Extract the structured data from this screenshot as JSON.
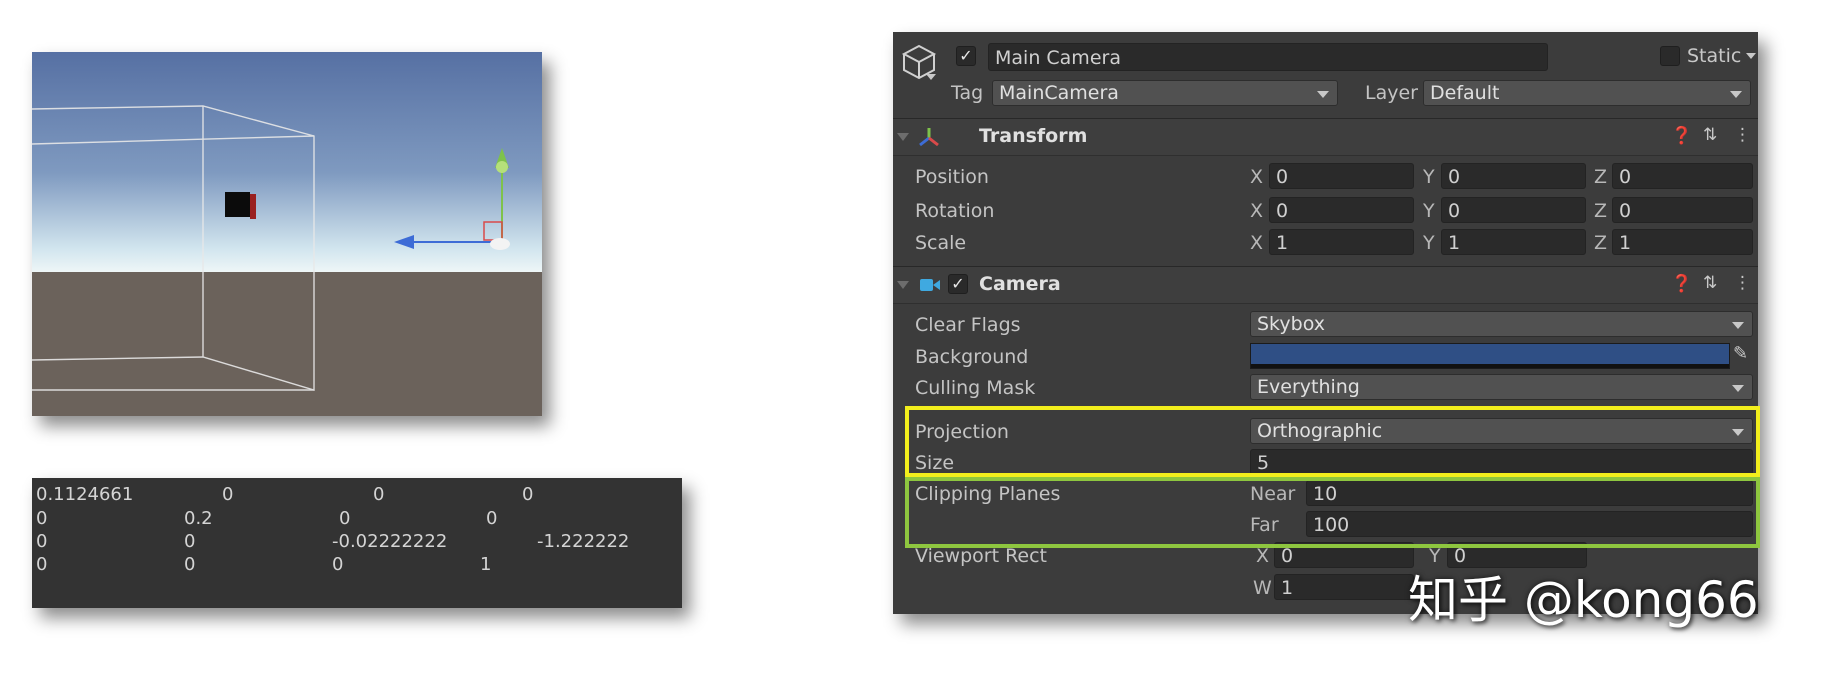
{
  "matrix": {
    "rows": [
      [
        "0.1124661",
        "0",
        "0",
        "0"
      ],
      [
        "0",
        "0.2",
        "0",
        "0"
      ],
      [
        "0",
        "0",
        "-0.02222222",
        "-1.222222"
      ],
      [
        "0",
        "0",
        "0",
        "1"
      ]
    ]
  },
  "inspector": {
    "object": {
      "active": true,
      "name": "Main Camera",
      "static_label": "Static",
      "tag_label": "Tag",
      "tag_value": "MainCamera",
      "layer_label": "Layer",
      "layer_value": "Default"
    },
    "transform": {
      "title": "Transform",
      "rows": [
        {
          "label": "Position",
          "x": "0",
          "y": "0",
          "z": "0"
        },
        {
          "label": "Rotation",
          "x": "0",
          "y": "0",
          "z": "0"
        },
        {
          "label": "Scale",
          "x": "1",
          "y": "1",
          "z": "1"
        }
      ]
    },
    "camera": {
      "title": "Camera",
      "enabled": true,
      "clear_flags_label": "Clear Flags",
      "clear_flags_value": "Skybox",
      "background_label": "Background",
      "background_color": "#2f4f85",
      "culling_mask_label": "Culling Mask",
      "culling_mask_value": "Everything",
      "projection_label": "Projection",
      "projection_value": "Orthographic",
      "size_label": "Size",
      "size_value": "5",
      "clipping_label": "Clipping Planes",
      "near_label": "Near",
      "near_value": "10",
      "far_label": "Far",
      "far_value": "100",
      "viewport_label": "Viewport Rect",
      "viewport_x": "0",
      "viewport_y": "0",
      "viewport_w": "1"
    },
    "axes": {
      "x": "X",
      "y": "Y",
      "z": "Z",
      "w": "W"
    }
  },
  "watermark": "知乎 @kong66",
  "colors": {
    "highlight_yellow": "#f2ee1c",
    "highlight_green": "#8ec63f",
    "inspector_bg": "#3c3c3c",
    "sky_top": "#5a74a6",
    "ground": "#6b625b"
  }
}
